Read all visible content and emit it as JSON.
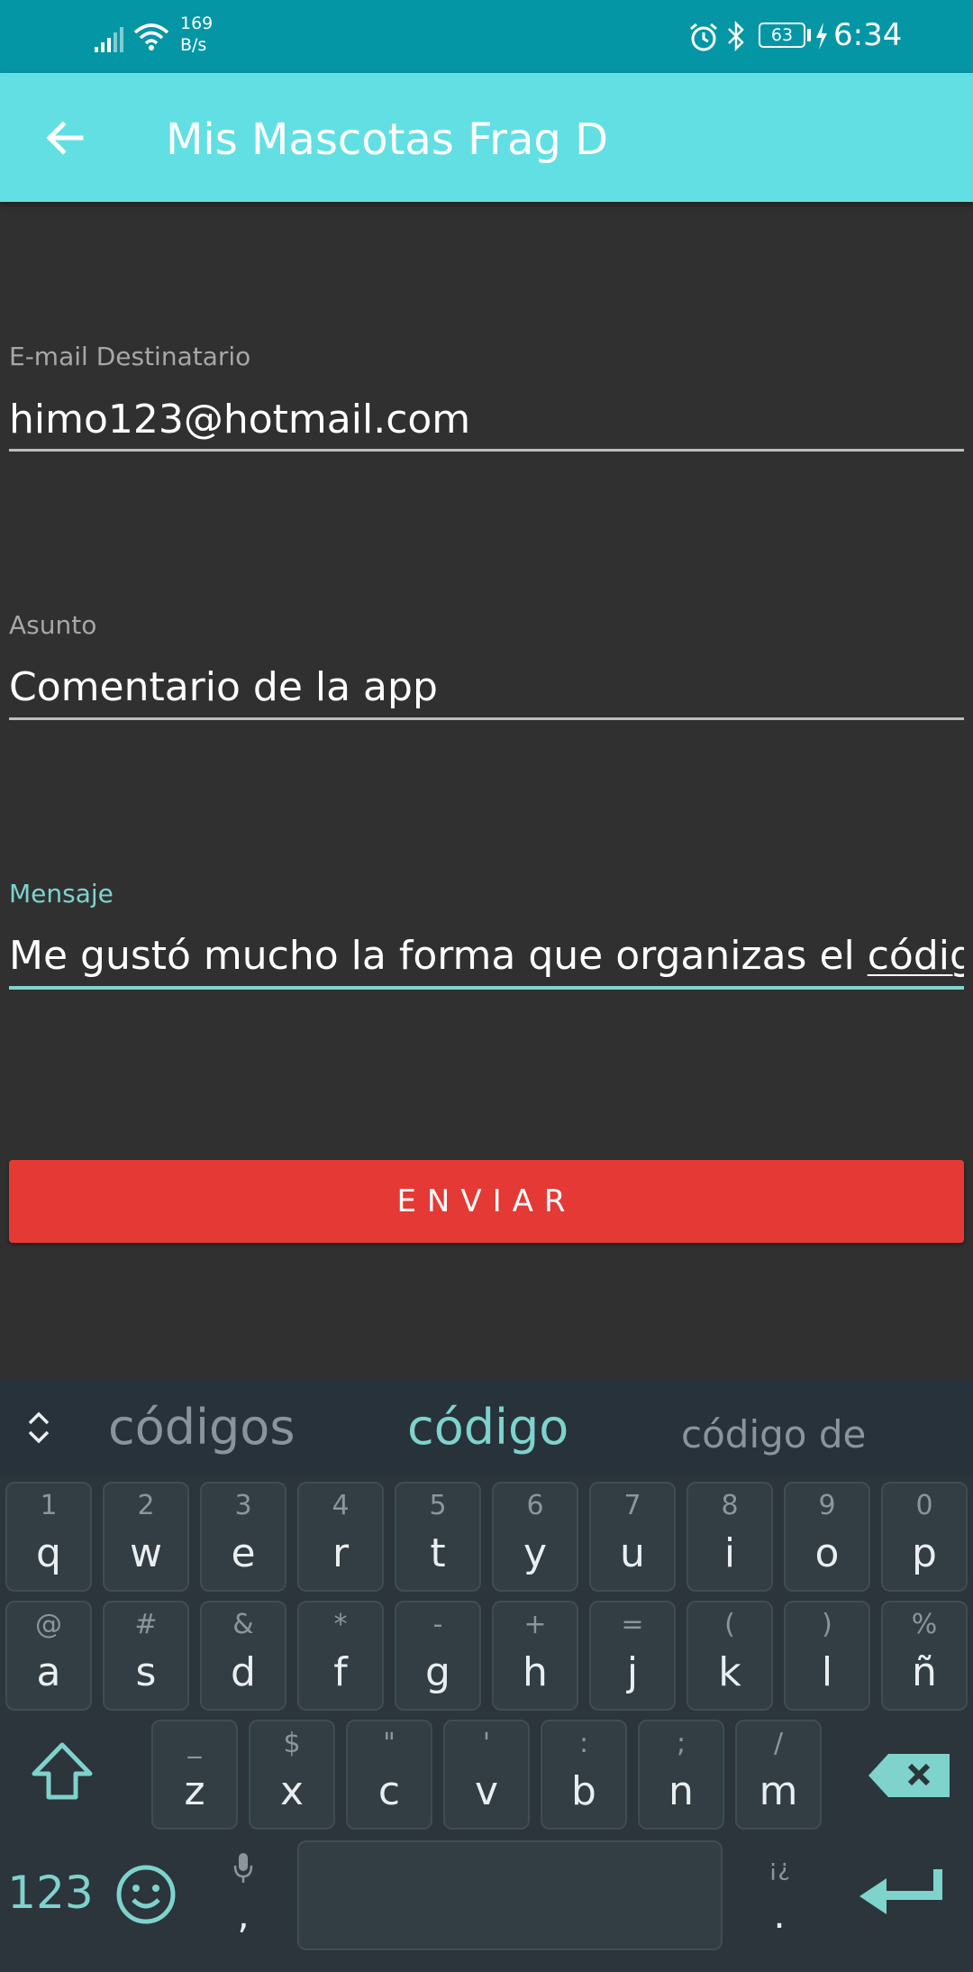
{
  "status_bar": {
    "speed_value": "169",
    "speed_unit": "B/s",
    "battery": "63",
    "time": "6:34"
  },
  "app_bar": {
    "title": "Mis Mascotas Frag D"
  },
  "form": {
    "email": {
      "label": "E-mail Destinatario",
      "value": "himo123@hotmail.com"
    },
    "subject": {
      "label": "Asunto",
      "value": "Comentario de la app"
    },
    "message": {
      "label": "Mensaje",
      "value_prefix": "Me gustó mucho la forma que organizas el ",
      "composing": "código"
    },
    "send_label": "ENVIAR"
  },
  "keyboard": {
    "suggestions": [
      "códigos",
      "código",
      "código de"
    ],
    "row1": [
      {
        "hint": "1",
        "key": "q"
      },
      {
        "hint": "2",
        "key": "w"
      },
      {
        "hint": "3",
        "key": "e"
      },
      {
        "hint": "4",
        "key": "r"
      },
      {
        "hint": "5",
        "key": "t"
      },
      {
        "hint": "6",
        "key": "y"
      },
      {
        "hint": "7",
        "key": "u"
      },
      {
        "hint": "8",
        "key": "i"
      },
      {
        "hint": "9",
        "key": "o"
      },
      {
        "hint": "0",
        "key": "p"
      }
    ],
    "row2": [
      {
        "hint": "@",
        "key": "a"
      },
      {
        "hint": "#",
        "key": "s"
      },
      {
        "hint": "&",
        "key": "d"
      },
      {
        "hint": "*",
        "key": "f"
      },
      {
        "hint": "-",
        "key": "g"
      },
      {
        "hint": "+",
        "key": "h"
      },
      {
        "hint": "=",
        "key": "j"
      },
      {
        "hint": "(",
        "key": "k"
      },
      {
        "hint": ")",
        "key": "l"
      },
      {
        "hint": "%",
        "key": "ñ"
      }
    ],
    "row3": [
      {
        "hint": "_",
        "key": "z"
      },
      {
        "hint": "$",
        "key": "x"
      },
      {
        "hint": "\"",
        "key": "c"
      },
      {
        "hint": "'",
        "key": "v"
      },
      {
        "hint": ":",
        "key": "b"
      },
      {
        "hint": ";",
        "key": "n"
      },
      {
        "hint": "/",
        "key": "m"
      }
    ],
    "numbers_label": "123",
    "comma": ",",
    "period_hint": "¡¿",
    "period": ".",
    "accent_color": "#7ed3cc"
  },
  "colors": {
    "status_bar": "#0596a6",
    "app_bar": "#62dfe3",
    "background": "#303030",
    "send_button": "#e53935"
  }
}
